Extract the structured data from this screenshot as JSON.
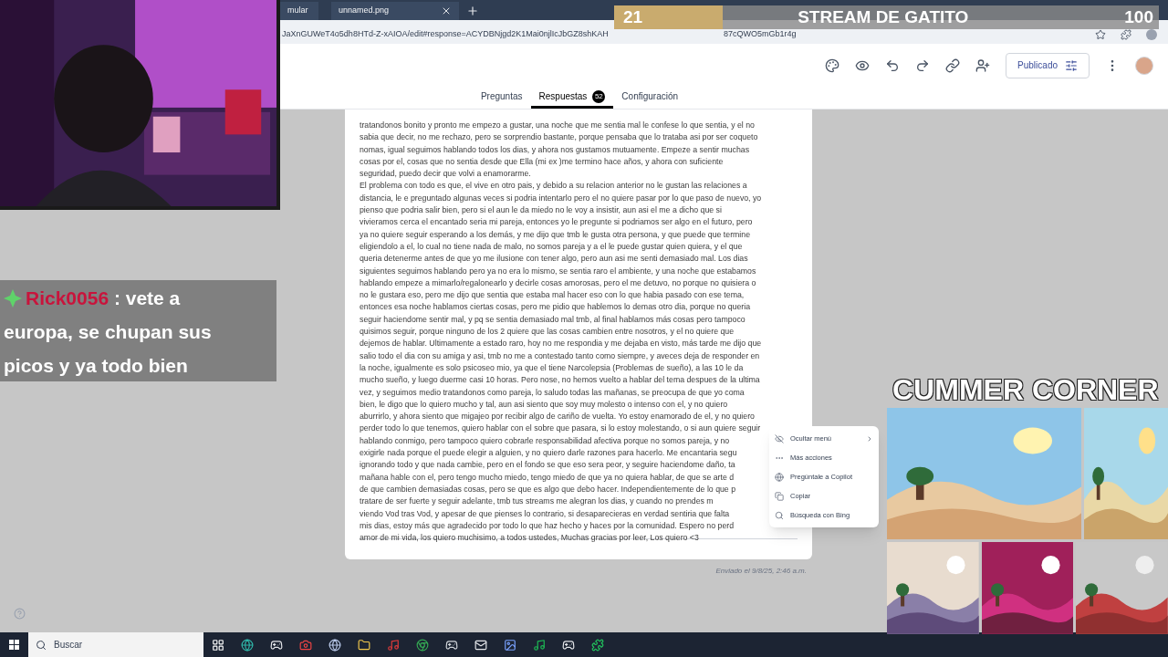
{
  "browser": {
    "tabs": [
      "mular",
      "unnamed.png"
    ],
    "url": "JaXnGUWeT4o5dh8HTd-Z-xAIOA/edit#response=ACYDBNjgd2K1Mai0njlIcJbGZ8shKAH",
    "url_tail": "87cQWO5mGb1r4g"
  },
  "form": {
    "publish_button": "Publicado",
    "tabs": [
      {
        "label": "Preguntas",
        "selected": false
      },
      {
        "label": "Respuestas",
        "selected": true,
        "count": "52"
      },
      {
        "label": "Configuración",
        "selected": false
      }
    ],
    "answer_lines": [
      "tratandonos bonito y pronto me empezo a gustar, una noche que me sentia mal le confese lo que sentia, y el no",
      "sabia que decir, no me rechazo, pero se sorprendio bastante, porque pensaba que lo trataba asi por ser coqueto",
      "nomas, igual seguimos hablando todos los dias, y ahora nos gustamos mutuamente. Empeze a sentir muchas",
      "cosas por el, cosas que no sentia desde que Ella (mi ex )me termino hace años, y ahora con suficiente",
      "seguridad, puedo decir que volvi a enamorarme.",
      "El problema con todo es que, el vive en otro pais, y debido a su relacion anterior no le gustan las relaciones a",
      "distancia, le e preguntado algunas veces si podria intentarlo pero el no quiere pasar por lo que paso de nuevo, yo",
      "pienso que podria salir bien, pero si el aun le da miedo no le voy a insistir, aun asi el me a dicho que si",
      "vivieramos cerca el encantado seria mi pareja, entonces yo le pregunte si podriamos ser algo en el futuro, pero",
      "ya no quiere seguir esperando a los demás, y me dijo que tmb le gusta otra persona, y que puede que termine",
      "eligiendolo a el, lo cual no tiene nada de malo, no somos pareja y a el le puede gustar quien quiera, y el que",
      "queria detenerme antes de que yo me ilusione con tener algo, pero aun asi me senti demasiado mal. Los dias",
      "siguientes seguimos hablando pero ya no era lo mismo, se sentia raro el ambiente, y una noche que estabamos",
      "hablando empeze a mimarlo/regalonearlo y decirle cosas amorosas, pero el me detuvo, no porque no quisiera o",
      "no le gustara eso, pero me dijo que sentia que estaba mal hacer eso con lo que habia pasado con ese tema,",
      "entonces esa noche hablamos ciertas cosas, pero me pidio que hablemos lo demas otro dia, porque no queria",
      "seguir haciendome sentir mal, y pq se sentia demasiado mal tmb, al final hablamos más cosas pero tampoco",
      "quisimos seguir, porque ninguno de los 2 quiere que las cosas cambien entre nosotros, y el no quiere que",
      "dejemos de hablar. Ultimamente a estado raro, hoy no me respondia y me dejaba en visto, más tarde me dijo que",
      "salio todo el dia con su amiga y asi, tmb no me a contestado tanto como siempre, y aveces deja de responder en",
      "la noche, igualmente es solo psicoseo mio, ya que el tiene Narcolepsia (Problemas de sueño), a las 10 le da",
      "mucho sueño, y luego duerme casi 10 horas. Pero nose, no hemos vuelto a hablar del tema despues de la ultima",
      "vez, y seguimos medio tratandonos como pareja, lo saludo todas las mañanas, se preocupa de que yo coma",
      "bien, le digo que lo quiero mucho y tal, aun asi siento que soy muy molesto o intenso con el, y no quiero",
      "aburrirlo, y ahora siento que migajeo por recibir algo de cariño de vuelta. Yo estoy enamorado de el, y no quiero",
      "perder todo lo que tenemos, quiero hablar con el sobre que pasara, si lo estoy molestando, o si aun quiere seguir",
      "hablando conmigo, pero tampoco quiero cobrarle responsabilidad afectiva porque no somos pareja, y no",
      "exigirle nada porque el puede elegir a alguien, y no quiero darle razones para hacerlo. Me encantaria segu",
      "ignorando todo y que nada cambie, pero en el fondo se que eso sera peor, y seguire haciendome daño, ta",
      "mañana hable con el, pero tengo mucho miedo, tengo miedo de que ya no quiera hablar, de que se arte d",
      "de que cambien demasiadas cosas, pero se que es algo que debo hacer. Independientemente de lo que p",
      "tratare de ser fuerte y seguir adelante, tmb tus streams me alegran los dias, y cuando no prendes m",
      "viendo Vod tras Vod, y apesar de que pienses lo contrario, si desaparecieras en verdad sentiria que falta",
      "mis dias, estoy más que agradecido por todo lo que haz hecho y haces por la comunidad. Espero no perd",
      "amor de mi vida, los quiero muchisimo, a todos ustedes, Muchas gracias por leer, Los quiero <3"
    ],
    "submitted": "Enviado el 9/8/25, 2:46 a.m."
  },
  "context_menu": [
    {
      "label": "Ocultar menú",
      "submenu": true
    },
    {
      "label": "Más acciones",
      "submenu": false
    },
    {
      "label": "Pregúntale a Copilot",
      "submenu": false
    },
    {
      "label": "Copiar",
      "submenu": false
    },
    {
      "label": "Búsqueda con Bing",
      "submenu": false
    }
  ],
  "goal": {
    "count": "21",
    "title": "STREAM DE GATITO",
    "target": "100",
    "level": 0.2
  },
  "chat": {
    "user": "Rick0056",
    "message": ": vete a europa, se chupan sus picos y ya todo bien"
  },
  "corner": {
    "title": "CUMMER CORNER"
  },
  "taskbar": {
    "search_placeholder": "Buscar"
  }
}
